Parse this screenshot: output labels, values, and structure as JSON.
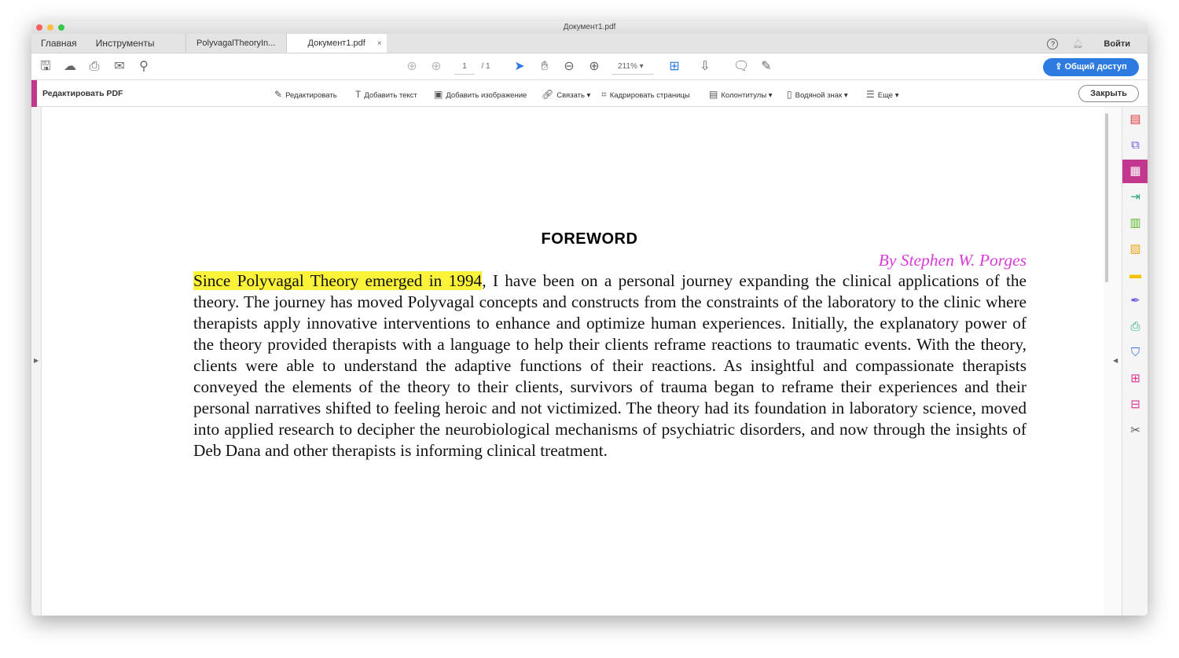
{
  "window": {
    "title": "Документ1.pdf"
  },
  "tabs": {
    "home": "Главная",
    "tools": "Инструменты",
    "doc1": "PolyvagalTheoryIn...",
    "doc2": "Документ1.pdf",
    "close": "×"
  },
  "header": {
    "signin": "Войти",
    "help": "?"
  },
  "toolbar": {
    "page_current": "1",
    "page_total": "/ 1",
    "zoom": "211%",
    "share": "Общий доступ"
  },
  "editbar": {
    "title": "Редактировать PDF",
    "items": [
      "Редактировать",
      "Добавить текст",
      "Добавить изображение",
      "Связать",
      "Кадрировать страницы",
      "Колонтитулы",
      "Водяной знак",
      "Еще"
    ],
    "close": "Закрыть"
  },
  "document": {
    "title": "FOREWORD",
    "byline": "By Stephen W. Porges",
    "highlight": "Since Polyvagal Theory emerged in 1994",
    "body": ", I have been on a  personal journey expanding the clinical applications of the theory. The journey has moved Polyvagal concepts and constructs from the constraints of the laboratory to the clinic where therapists apply innovative interventions to enhance and optimize human experiences. Initially, the explanatory power of the theory provided therapists with a language to help their clients reframe reactions to traumatic events. With the theory, clients were able to understand the adaptive functions of their reactions. As insightful and compassionate therapists conveyed the elements of the theory to their clients, survivors of trauma began to reframe their experiences and their personal narratives shifted to feeling heroic and not victimized. The theory had its foundation in laboratory science, moved into applied research to decipher the neurobiological mechanisms of psychiatric disorders, and now through the insights of Deb Dana and other therapists is informing clinical treatment."
  },
  "colors": {
    "accent": "#c2388f",
    "share": "#2d7be0",
    "highlight": "#fbf33a",
    "byline": "#d83bd8"
  }
}
